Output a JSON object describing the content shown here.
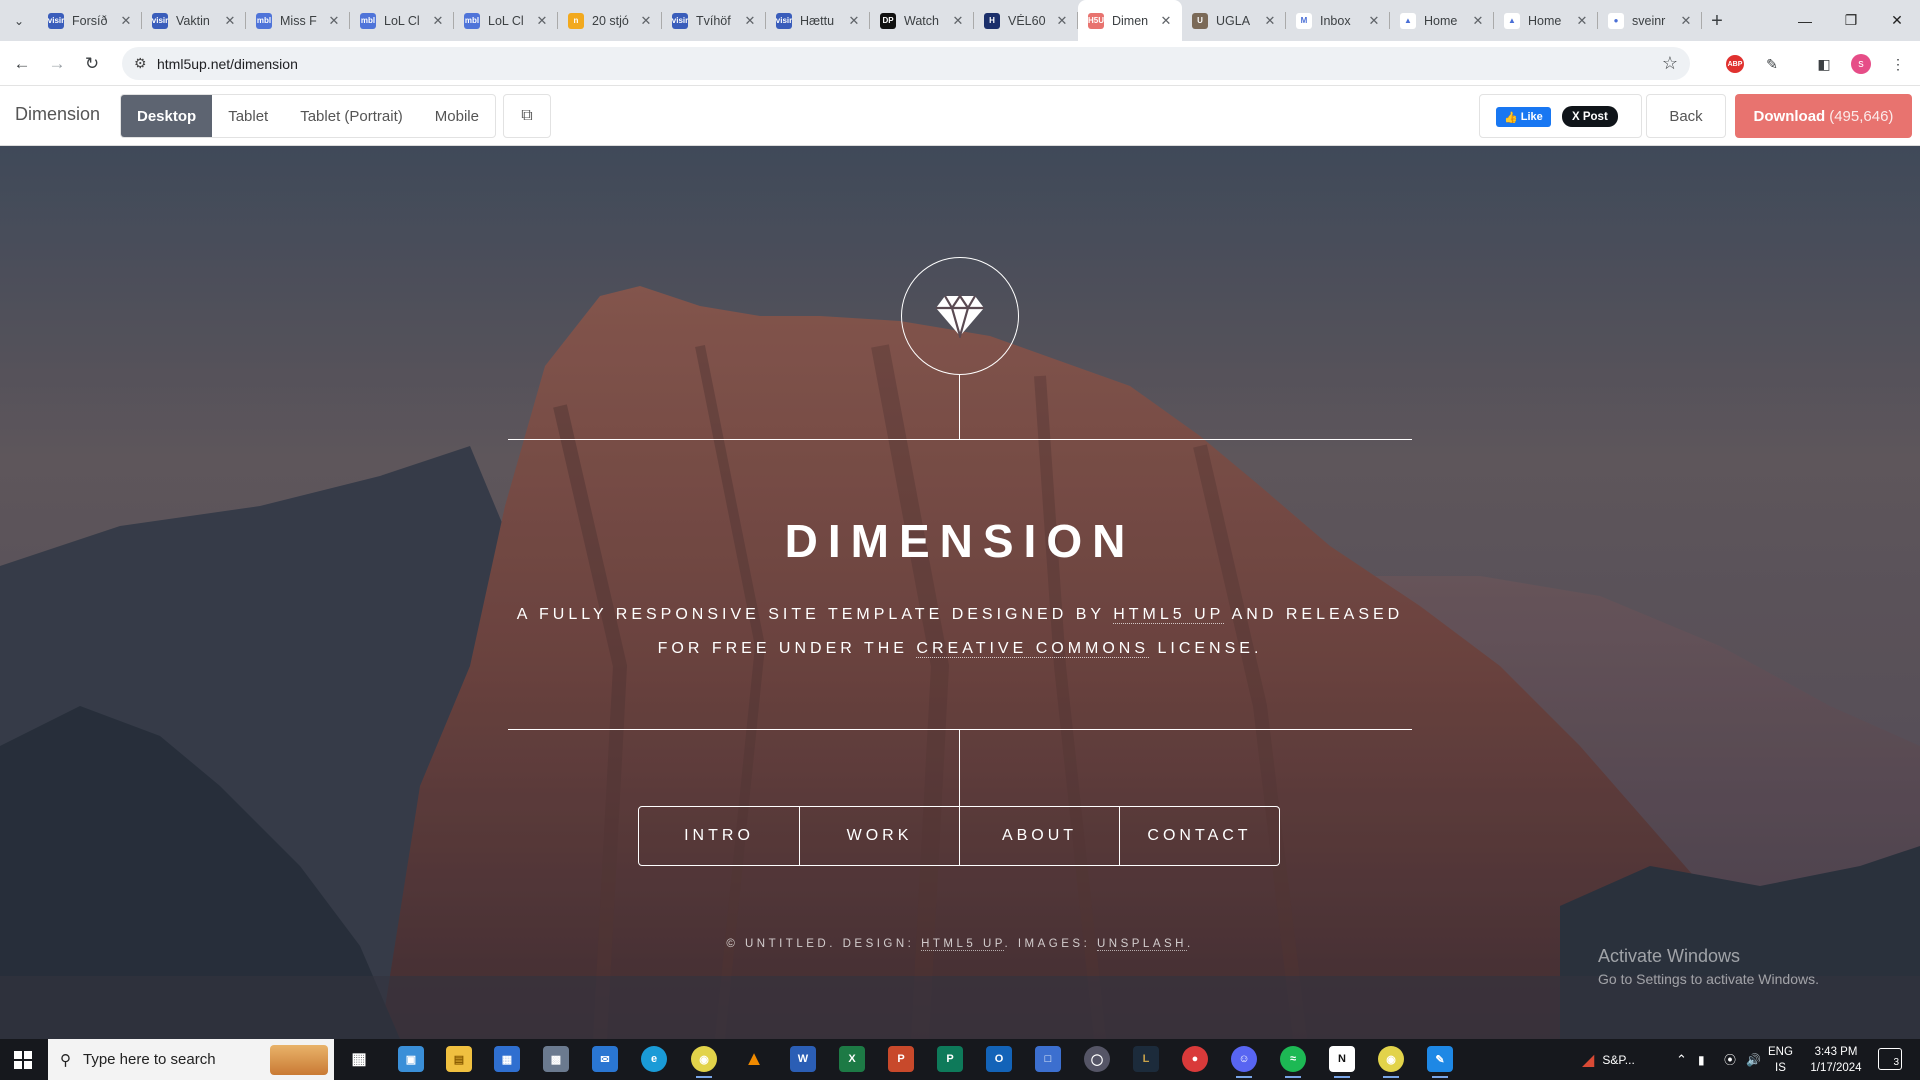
{
  "browser": {
    "tabs": [
      {
        "title": "Forsíð",
        "favicon_color": "#3a5dbb",
        "favicon_text": "visir"
      },
      {
        "title": "Vaktin",
        "favicon_color": "#3a5dbb",
        "favicon_text": "visir"
      },
      {
        "title": "Miss F",
        "favicon_color": "#4f74d9",
        "favicon_text": "mbl"
      },
      {
        "title": "LoL Cl",
        "favicon_color": "#4f74d9",
        "favicon_text": "mbl"
      },
      {
        "title": "LoL Cl",
        "favicon_color": "#4f74d9",
        "favicon_text": "mbl"
      },
      {
        "title": "20 stjó",
        "favicon_color": "#f2a91e",
        "favicon_text": "n"
      },
      {
        "title": "Tvíhöf",
        "favicon_color": "#3a5dbb",
        "favicon_text": "visir"
      },
      {
        "title": "Hættu",
        "favicon_color": "#3a5dbb",
        "favicon_text": "visir"
      },
      {
        "title": "Watch",
        "favicon_color": "#111111",
        "favicon_text": "DP"
      },
      {
        "title": "VÉL60",
        "favicon_color": "#1b2f6b",
        "favicon_text": "H"
      },
      {
        "title": "Dimen",
        "favicon_color": "#e8736f",
        "favicon_text": "H5U"
      },
      {
        "title": "UGLA",
        "favicon_color": "#7b6a58",
        "favicon_text": "U"
      },
      {
        "title": "Inbox",
        "favicon_color": "#ffffff",
        "favicon_text": "M"
      },
      {
        "title": "Home",
        "favicon_color": "#ffffff",
        "favicon_text": "▲"
      },
      {
        "title": "Home",
        "favicon_color": "#ffffff",
        "favicon_text": "▲"
      },
      {
        "title": "sveinr",
        "favicon_color": "#ffffff",
        "favicon_text": "●"
      }
    ],
    "active_tab_index": 10,
    "url": "html5up.net/dimension",
    "profile_initial": "s",
    "abp_label": "ABP"
  },
  "previewbar": {
    "title": "Dimension",
    "devices": [
      "Desktop",
      "Tablet",
      "Tablet (Portrait)",
      "Mobile"
    ],
    "active_device": "Desktop",
    "fb_like": "Like",
    "x_post": "X Post",
    "back": "Back",
    "download_label": "Download",
    "download_count": "(495,646)"
  },
  "site": {
    "title": "DIMENSION",
    "subtitle_line1_pre": "A fully responsive site template designed by ",
    "subtitle_link1": "HTML5 UP",
    "subtitle_line1_post": " and released",
    "subtitle_line2_pre": "for free under the ",
    "subtitle_link2": "Creative Commons",
    "subtitle_line2_post": " license.",
    "nav": [
      "INTRO",
      "WORK",
      "ABOUT",
      "CONTACT"
    ],
    "footer_pre": "© Untitled. Design: ",
    "footer_link1": "HTML5 UP",
    "footer_mid": ". Images: ",
    "footer_link2": "Unsplash",
    "footer_post": "."
  },
  "watermark": {
    "line1": "Activate Windows",
    "line2": "Go to Settings to activate Windows."
  },
  "taskbar": {
    "search_placeholder": "Type here to search",
    "tray_app_label": "S&P...",
    "lang_line1": "ENG",
    "lang_line2": "IS",
    "time": "3:43 PM",
    "date": "1/17/2024",
    "notification_count": "3"
  }
}
